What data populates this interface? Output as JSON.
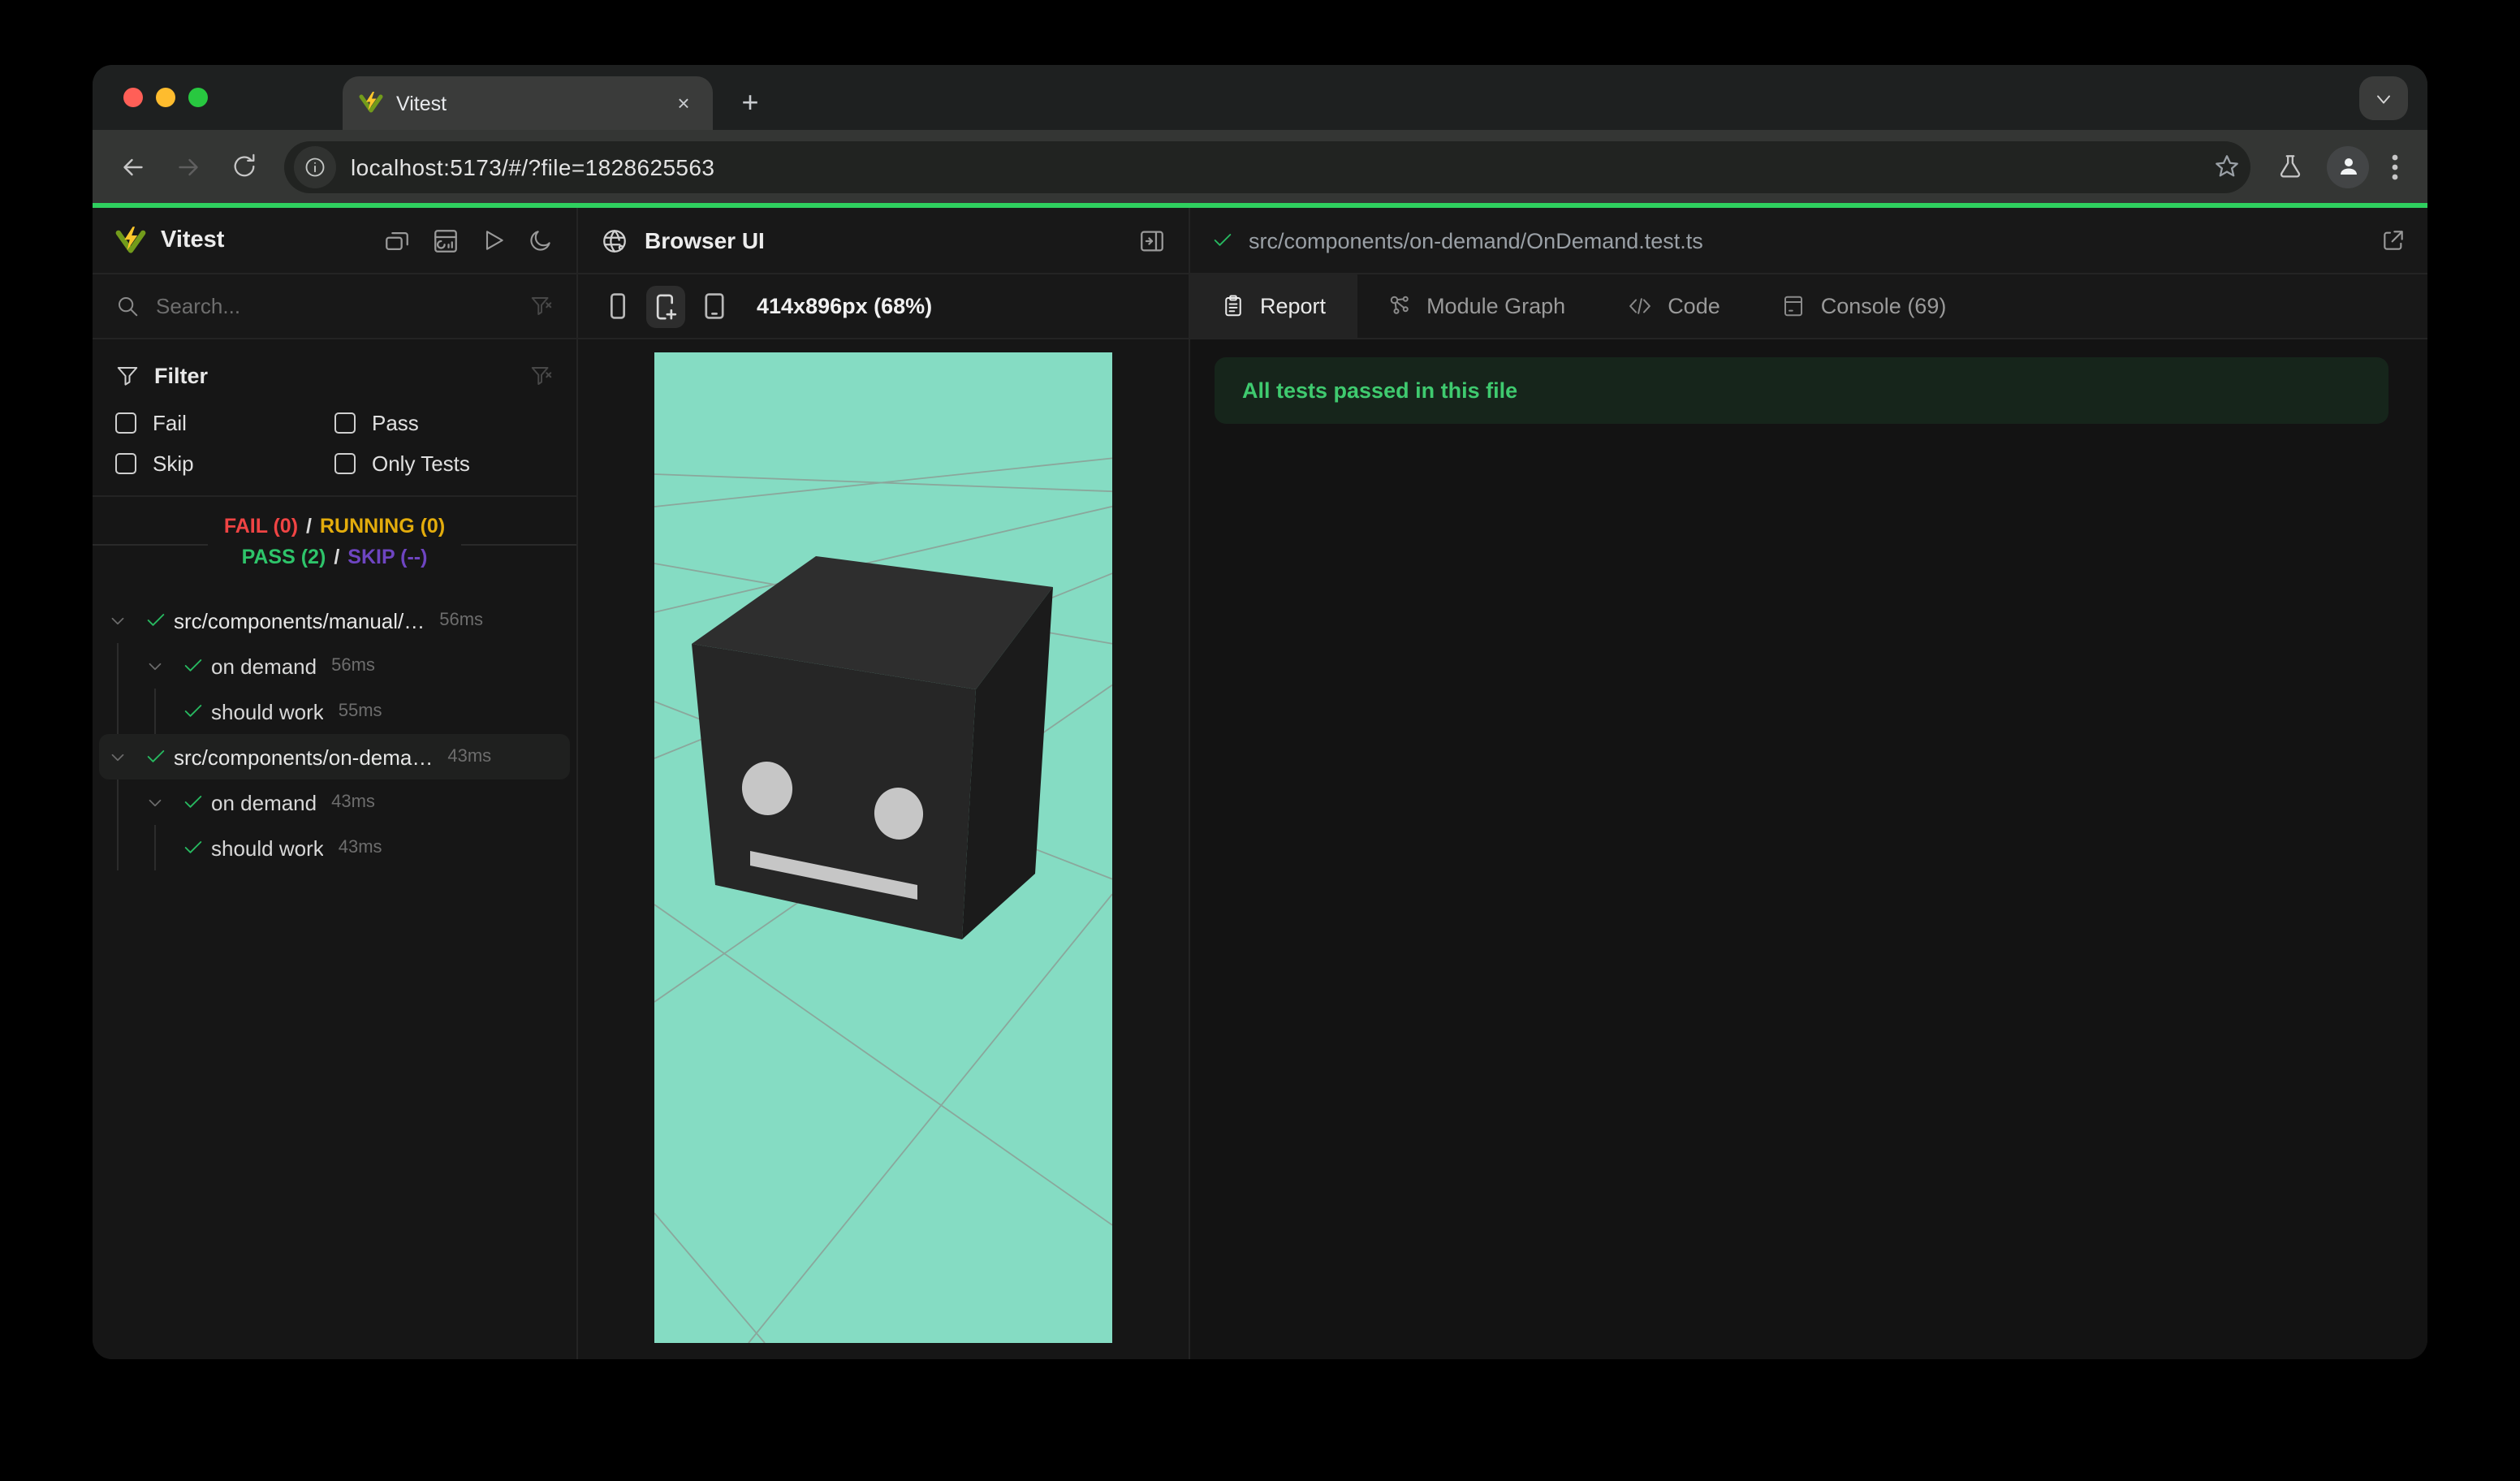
{
  "browser_chrome": {
    "tab_title": "Vitest",
    "close_glyph": "×",
    "new_tab_glyph": "+",
    "url": "localhost:5173/#/?file=1828625563"
  },
  "sidebar": {
    "app_name": "Vitest",
    "search": {
      "placeholder": "Search..."
    },
    "filter": {
      "title": "Filter",
      "options": [
        {
          "label": "Fail",
          "checked": false
        },
        {
          "label": "Pass",
          "checked": false
        },
        {
          "label": "Skip",
          "checked": false
        },
        {
          "label": "Only Tests",
          "checked": false
        }
      ]
    },
    "summary": {
      "fail": "FAIL (0)",
      "sep1": "/",
      "running": "RUNNING (0)",
      "pass": "PASS (2)",
      "sep2": "/",
      "skip": "SKIP (--)"
    },
    "tree": [
      {
        "label": "src/components/manual/…",
        "duration": "56ms",
        "status": "pass",
        "level": 1,
        "selected": false
      },
      {
        "label": "on demand",
        "duration": "56ms",
        "status": "pass",
        "level": 2,
        "selected": false
      },
      {
        "label": "should work",
        "duration": "55ms",
        "status": "pass",
        "level": 3,
        "selected": false
      },
      {
        "label": "src/components/on-dema…",
        "duration": "43ms",
        "status": "pass",
        "level": 1,
        "selected": true
      },
      {
        "label": "on demand",
        "duration": "43ms",
        "status": "pass",
        "level": 2,
        "selected": false
      },
      {
        "label": "should work",
        "duration": "43ms",
        "status": "pass",
        "level": 3,
        "selected": false
      }
    ]
  },
  "preview": {
    "title": "Browser UI",
    "viewport_label": "414x896px (68%)"
  },
  "report": {
    "file_path": "src/components/on-demand/OnDemand.test.ts",
    "tabs": [
      {
        "label": "Report",
        "active": true
      },
      {
        "label": "Module Graph",
        "active": false
      },
      {
        "label": "Code",
        "active": false
      },
      {
        "label": "Console (69)",
        "active": false
      }
    ],
    "banner": "All tests passed in this file"
  },
  "colors": {
    "accent_green": "#2fd05f",
    "fail": "#ef4444",
    "running": "#e3ac0c",
    "pass": "#2ec46a",
    "skip": "#6e45c1",
    "check": "#27b960",
    "banner_text": "#3fca6f",
    "canvas_teal": "#85dcc3",
    "traffic_red": "#ff5f57",
    "traffic_yellow": "#febc2e",
    "traffic_green": "#28c840"
  }
}
